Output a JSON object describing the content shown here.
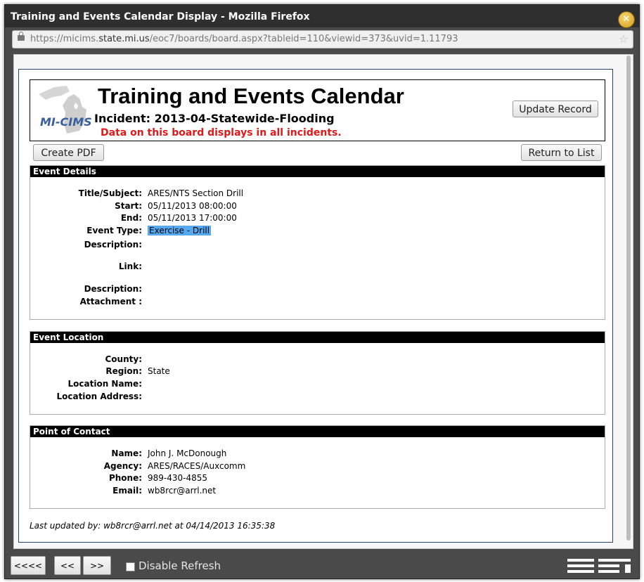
{
  "window": {
    "title": "Training and Events Calendar Display - Mozilla Firefox",
    "url_prefix": "https://micims.",
    "url_domain": "state.mi.us",
    "url_path": "/eoc7/boards/board.aspx?tableid=110&viewid=373&uvid=1.11793"
  },
  "header": {
    "logo_text": "MI-CIMS",
    "title": "Training and Events Calendar",
    "incident": "Incident: 2013-04-Statewide-Flooding",
    "warning": "Data on this board displays in all incidents.",
    "update_button": "Update Record"
  },
  "toolbar": {
    "create_pdf": "Create PDF",
    "return_to_list": "Return to List"
  },
  "event_details": {
    "heading": "Event Details",
    "title_label": "Title/Subject:",
    "title_value": "ARES/NTS Section Drill",
    "start_label": "Start:",
    "start_value": "05/11/2013 08:00:00",
    "end_label": "End:",
    "end_value": "05/11/2013 17:00:00",
    "type_label": "Event Type:",
    "type_value": "Exercise - Drill",
    "description_label": "Description:",
    "link_label": "Link:",
    "description2_label": "Description:",
    "attachment_label": "Attachment :"
  },
  "event_location": {
    "heading": "Event Location",
    "county_label": "County:",
    "region_label": "Region:",
    "region_value": "State",
    "location_name_label": "Location Name:",
    "location_address_label": "Location Address:"
  },
  "contact": {
    "heading": "Point of Contact",
    "name_label": "Name:",
    "name_value": "John J. McDonough",
    "agency_label": "Agency:",
    "agency_value": "ARES/RACES/Auxcomm",
    "phone_label": "Phone:",
    "phone_value": "989-430-4855",
    "email_label": "Email:",
    "email_value": "wb8rcr@arrl.net"
  },
  "footer": {
    "last_updated": "Last updated by: wb8rcr@arrl.net  at 04/14/2013 16:35:38"
  },
  "bottombar": {
    "first": "<<<<",
    "prev": "<<",
    "next": ">>",
    "disable_refresh": "Disable Refresh"
  }
}
